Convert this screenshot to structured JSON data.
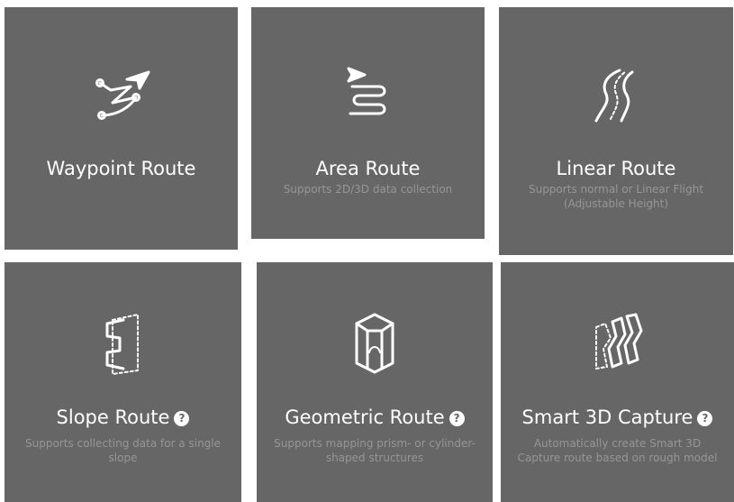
{
  "routes": [
    {
      "title": "Waypoint Route",
      "description": "",
      "icon": "waypoint-route-icon",
      "has_help": false
    },
    {
      "title": "Area Route",
      "description": "Supports 2D/3D data collection",
      "icon": "area-route-icon",
      "has_help": false
    },
    {
      "title": "Linear Route",
      "description": "Supports normal or Linear Flight (Adjustable Height)",
      "icon": "linear-route-icon",
      "has_help": false
    },
    {
      "title": "Slope Route",
      "description": "Supports collecting data for a single slope",
      "icon": "slope-route-icon",
      "has_help": true
    },
    {
      "title": "Geometric Route",
      "description": "Supports mapping prism- or cylinder-shaped structures",
      "icon": "geometric-route-icon",
      "has_help": true
    },
    {
      "title": "Smart 3D Capture",
      "description": "Automatically create Smart 3D Capture route based on rough model",
      "icon": "smart-3d-capture-icon",
      "has_help": true
    }
  ],
  "help_glyph": "?",
  "colors": {
    "card_background": "#666666",
    "title_text": "#ffffff",
    "description_text": "#969696",
    "page_background": "#ffffff"
  }
}
